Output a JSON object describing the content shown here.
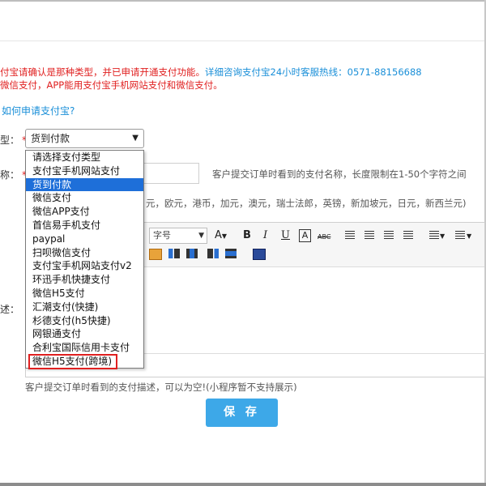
{
  "notice": {
    "line1_red": "付宝请确认是那种类型，并已申请开通支付功能。",
    "line1_blue": "详细咨询支付宝24小时客服热线：0571-88156688",
    "line2": "微信支付，APP能用支付宝手机网站支付和微信支付。"
  },
  "howto_link": "如何申请支付宝?",
  "labels": {
    "type": "型：",
    "name": "称：",
    "desc": "述："
  },
  "required_mark": "*",
  "payment_type": {
    "selected": "货到付款",
    "options": [
      "请选择支付类型",
      "支付宝手机网站支付",
      "货到付款",
      "微信支付",
      "微信APP支付",
      "首信易手机支付",
      "paypal",
      "扫呗微信支付",
      "支付宝手机网站支付v2",
      "环迅手机快捷支付",
      "微信H5支付",
      "汇潮支付(快捷)",
      "杉德支付(h5快捷)",
      "网银通支付",
      "合利宝国际信用卡支付",
      "微信H5支付(跨境)"
    ]
  },
  "name_hint": "客户提交订单时看到的支付名称，长度限制在1-50个字符之间",
  "currency_text": "元，欧元，港币，加元，澳元，瑞士法郎，英镑，新加坡元，日元，新西兰元)",
  "editor": {
    "font_size_placeholder": "字号",
    "font_color": "A",
    "bold": "B",
    "italic": "I",
    "underline": "U",
    "border_a": "A",
    "strike": "ABC"
  },
  "desc_hint": "客户提交订单时看到的支付描述，可以为空!(小程序暂不支持展示)",
  "save_label": "保 存"
}
